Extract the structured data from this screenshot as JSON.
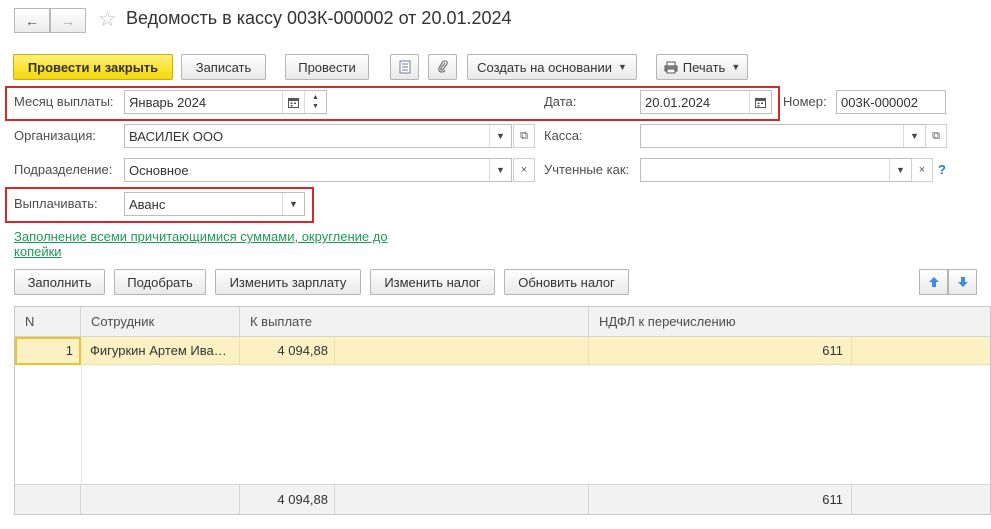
{
  "window": {
    "title": "Ведомость в кассу 003К-000002 от 20.01.2024",
    "back_icon": "←",
    "forward_icon": "→",
    "star_icon": "☆"
  },
  "toolbar": {
    "post_close": "Провести и закрыть",
    "save": "Записать",
    "post": "Провести",
    "create_based": "Создать на основании",
    "print": "Печать"
  },
  "form": {
    "month_label": "Месяц выплаты:",
    "month_value": "Январь 2024",
    "date_label": "Дата:",
    "date_value": "20.01.2024",
    "number_label": "Номер:",
    "number_value": "003К-000002",
    "org_label": "Организация:",
    "org_value": "ВАСИЛЕК ООО",
    "cashbox_label": "Касса:",
    "cashbox_value": "",
    "dept_label": "Подразделение:",
    "dept_value": "Основное",
    "counted_label": "Учтенные как:",
    "counted_value": "",
    "help": "?",
    "pay_label": "Выплачивать:",
    "pay_value": "Аванс"
  },
  "link_text": "Заполнение всеми причитающимися суммами, округление до копейки",
  "table_toolbar": {
    "fill": "Заполнить",
    "pick": "Подобрать",
    "change_salary": "Изменить зарплату",
    "change_tax": "Изменить налог",
    "update_tax": "Обновить налог"
  },
  "table": {
    "headers": [
      "N",
      "Сотрудник",
      "К выплате",
      "НДФЛ к перечислению"
    ],
    "rows": [
      {
        "n": "1",
        "employee": "Фигуркин Артем Ива…",
        "amount": "4 094,88",
        "ndfl": "611"
      }
    ],
    "totals": {
      "amount": "4 094,88",
      "ndfl": "611"
    }
  },
  "colors": {
    "accent_primary": "#f5d90a",
    "highlight_box": "#d12b2b",
    "link": "#1e9a58",
    "selected_row": "#fbf1c3"
  }
}
